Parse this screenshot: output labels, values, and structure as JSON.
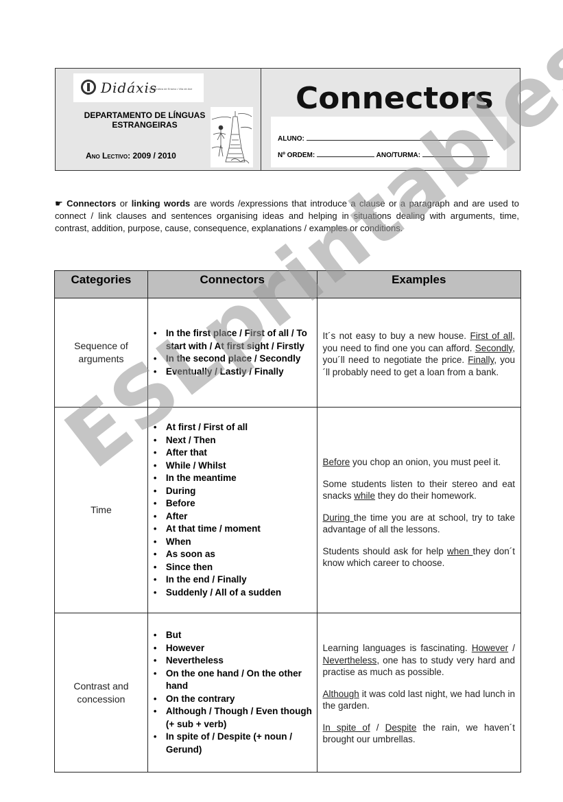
{
  "header": {
    "logo": {
      "name": "Didáxis",
      "tagline": "- Cooperativa de Ensino • Vila de Ave"
    },
    "department": [
      "DEPARTAMENTO DE LÍNGUAS",
      "ESTRANGEIRAS"
    ],
    "school_year_label": "Ano Lectivo:",
    "school_year_value": "2009 / 2010",
    "title": "Connectors",
    "form": {
      "student_label": "ALUNO:",
      "number_label": "Nº ORDEM:",
      "class_label": "ANO/TURMA:"
    }
  },
  "intro": {
    "icon": "pointing-hand-icon",
    "term1": "Connectors",
    "joiner": " or ",
    "term2": "linking words",
    "text": " are words /expressions that introduce a clause or a paragraph and are used to connect / link clauses and sentences organising ideas and helping in situations dealing with arguments, time, contrast, addition, purpose, cause, consequence, explanations / examples or conditions."
  },
  "table": {
    "headers": [
      "Categories",
      "Connectors",
      "Examples"
    ],
    "rows": [
      {
        "category": "Sequence of arguments",
        "connectors": [
          "In the first place / First of all / To start with / At first sight / Firstly",
          "In the second place / Secondly",
          "Eventually / Lastly / Finally"
        ],
        "examples": [
          {
            "parts": [
              {
                "t": "It´s not easy to buy a new house. "
              },
              {
                "t": "First of all",
                "u": true
              },
              {
                "t": ", you need to find one you can afford. "
              },
              {
                "t": "Secondly",
                "u": true
              },
              {
                "t": ", you´ll need to negotiate the price. "
              },
              {
                "t": "Finally",
                "u": true
              },
              {
                "t": ", you´ll probably need to get a loan from a bank."
              }
            ]
          }
        ]
      },
      {
        "category": "Time",
        "connectors": [
          "At first / First of all",
          "Next / Then",
          "After that",
          "While / Whilst",
          "In the meantime",
          "During",
          "Before",
          "After",
          "At that time / moment",
          "When",
          "As soon as",
          "Since then",
          "In the end / Finally",
          "Suddenly / All of a sudden"
        ],
        "examples": [
          {
            "parts": [
              {
                "t": "Before",
                "u": true
              },
              {
                "t": " you chop an onion, you must peel it."
              }
            ]
          },
          {
            "parts": [
              {
                "t": "Some students listen to their stereo and eat snacks "
              },
              {
                "t": "while",
                "u": true
              },
              {
                "t": " they do their homework."
              }
            ]
          },
          {
            "parts": [
              {
                "t": "During ",
                "u": true
              },
              {
                "t": "the time you are at school, try to take advantage of all the lessons."
              }
            ]
          },
          {
            "parts": [
              {
                "t": "Students should ask for help "
              },
              {
                "t": "when ",
                "u": true
              },
              {
                "t": "they don´t know which career to choose."
              }
            ]
          }
        ]
      },
      {
        "category": "Contrast and concession",
        "connectors": [
          "But",
          "However",
          "Nevertheless",
          "On the one hand / On the other hand",
          "On the contrary",
          "Although / Though / Even though (+ sub + verb)",
          "In spite of / Despite  (+ noun / Gerund)"
        ],
        "examples": [
          {
            "parts": [
              {
                "t": "Learning languages is fascinating. "
              },
              {
                "t": "However",
                "u": true
              },
              {
                "t": " / "
              },
              {
                "t": "Nevertheless",
                "u": true
              },
              {
                "t": ", one has to study very hard and practise as much as possible."
              }
            ]
          },
          {
            "parts": [
              {
                "t": "Although",
                "u": true
              },
              {
                "t": " it was cold last night, we had lunch in the garden."
              }
            ]
          },
          {
            "parts": [
              {
                "t": "In spite of",
                "u": true
              },
              {
                "t": " / "
              },
              {
                "t": "Despite",
                "u": true
              },
              {
                "t": " the rain, we haven´t brought our umbrellas."
              }
            ]
          }
        ]
      }
    ]
  },
  "watermark": "ESLprintables.com"
}
